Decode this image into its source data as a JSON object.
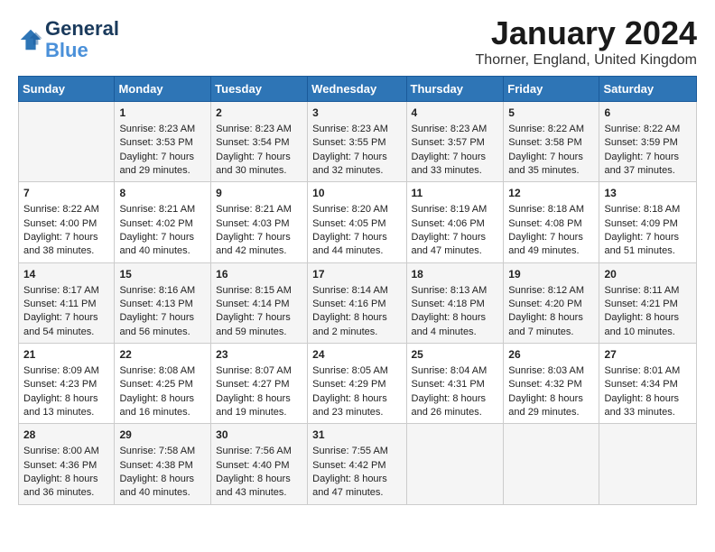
{
  "header": {
    "logo_line1": "General",
    "logo_line2": "Blue",
    "month_title": "January 2024",
    "location": "Thorner, England, United Kingdom"
  },
  "weekdays": [
    "Sunday",
    "Monday",
    "Tuesday",
    "Wednesday",
    "Thursday",
    "Friday",
    "Saturday"
  ],
  "weeks": [
    [
      {
        "day": "",
        "content": ""
      },
      {
        "day": "1",
        "content": "Sunrise: 8:23 AM\nSunset: 3:53 PM\nDaylight: 7 hours\nand 29 minutes."
      },
      {
        "day": "2",
        "content": "Sunrise: 8:23 AM\nSunset: 3:54 PM\nDaylight: 7 hours\nand 30 minutes."
      },
      {
        "day": "3",
        "content": "Sunrise: 8:23 AM\nSunset: 3:55 PM\nDaylight: 7 hours\nand 32 minutes."
      },
      {
        "day": "4",
        "content": "Sunrise: 8:23 AM\nSunset: 3:57 PM\nDaylight: 7 hours\nand 33 minutes."
      },
      {
        "day": "5",
        "content": "Sunrise: 8:22 AM\nSunset: 3:58 PM\nDaylight: 7 hours\nand 35 minutes."
      },
      {
        "day": "6",
        "content": "Sunrise: 8:22 AM\nSunset: 3:59 PM\nDaylight: 7 hours\nand 37 minutes."
      }
    ],
    [
      {
        "day": "7",
        "content": "Sunrise: 8:22 AM\nSunset: 4:00 PM\nDaylight: 7 hours\nand 38 minutes."
      },
      {
        "day": "8",
        "content": "Sunrise: 8:21 AM\nSunset: 4:02 PM\nDaylight: 7 hours\nand 40 minutes."
      },
      {
        "day": "9",
        "content": "Sunrise: 8:21 AM\nSunset: 4:03 PM\nDaylight: 7 hours\nand 42 minutes."
      },
      {
        "day": "10",
        "content": "Sunrise: 8:20 AM\nSunset: 4:05 PM\nDaylight: 7 hours\nand 44 minutes."
      },
      {
        "day": "11",
        "content": "Sunrise: 8:19 AM\nSunset: 4:06 PM\nDaylight: 7 hours\nand 47 minutes."
      },
      {
        "day": "12",
        "content": "Sunrise: 8:18 AM\nSunset: 4:08 PM\nDaylight: 7 hours\nand 49 minutes."
      },
      {
        "day": "13",
        "content": "Sunrise: 8:18 AM\nSunset: 4:09 PM\nDaylight: 7 hours\nand 51 minutes."
      }
    ],
    [
      {
        "day": "14",
        "content": "Sunrise: 8:17 AM\nSunset: 4:11 PM\nDaylight: 7 hours\nand 54 minutes."
      },
      {
        "day": "15",
        "content": "Sunrise: 8:16 AM\nSunset: 4:13 PM\nDaylight: 7 hours\nand 56 minutes."
      },
      {
        "day": "16",
        "content": "Sunrise: 8:15 AM\nSunset: 4:14 PM\nDaylight: 7 hours\nand 59 minutes."
      },
      {
        "day": "17",
        "content": "Sunrise: 8:14 AM\nSunset: 4:16 PM\nDaylight: 8 hours\nand 2 minutes."
      },
      {
        "day": "18",
        "content": "Sunrise: 8:13 AM\nSunset: 4:18 PM\nDaylight: 8 hours\nand 4 minutes."
      },
      {
        "day": "19",
        "content": "Sunrise: 8:12 AM\nSunset: 4:20 PM\nDaylight: 8 hours\nand 7 minutes."
      },
      {
        "day": "20",
        "content": "Sunrise: 8:11 AM\nSunset: 4:21 PM\nDaylight: 8 hours\nand 10 minutes."
      }
    ],
    [
      {
        "day": "21",
        "content": "Sunrise: 8:09 AM\nSunset: 4:23 PM\nDaylight: 8 hours\nand 13 minutes."
      },
      {
        "day": "22",
        "content": "Sunrise: 8:08 AM\nSunset: 4:25 PM\nDaylight: 8 hours\nand 16 minutes."
      },
      {
        "day": "23",
        "content": "Sunrise: 8:07 AM\nSunset: 4:27 PM\nDaylight: 8 hours\nand 19 minutes."
      },
      {
        "day": "24",
        "content": "Sunrise: 8:05 AM\nSunset: 4:29 PM\nDaylight: 8 hours\nand 23 minutes."
      },
      {
        "day": "25",
        "content": "Sunrise: 8:04 AM\nSunset: 4:31 PM\nDaylight: 8 hours\nand 26 minutes."
      },
      {
        "day": "26",
        "content": "Sunrise: 8:03 AM\nSunset: 4:32 PM\nDaylight: 8 hours\nand 29 minutes."
      },
      {
        "day": "27",
        "content": "Sunrise: 8:01 AM\nSunset: 4:34 PM\nDaylight: 8 hours\nand 33 minutes."
      }
    ],
    [
      {
        "day": "28",
        "content": "Sunrise: 8:00 AM\nSunset: 4:36 PM\nDaylight: 8 hours\nand 36 minutes."
      },
      {
        "day": "29",
        "content": "Sunrise: 7:58 AM\nSunset: 4:38 PM\nDaylight: 8 hours\nand 40 minutes."
      },
      {
        "day": "30",
        "content": "Sunrise: 7:56 AM\nSunset: 4:40 PM\nDaylight: 8 hours\nand 43 minutes."
      },
      {
        "day": "31",
        "content": "Sunrise: 7:55 AM\nSunset: 4:42 PM\nDaylight: 8 hours\nand 47 minutes."
      },
      {
        "day": "",
        "content": ""
      },
      {
        "day": "",
        "content": ""
      },
      {
        "day": "",
        "content": ""
      }
    ]
  ]
}
